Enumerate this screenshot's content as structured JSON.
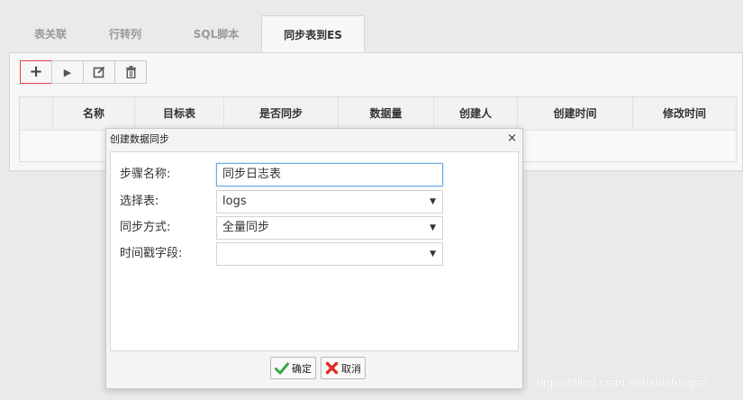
{
  "tabs": [
    "表关联",
    "行转列",
    "SQL脚本",
    "同步表到ES"
  ],
  "toolbar": {
    "add": "+",
    "run": "▶",
    "edit_icon": "edit-icon",
    "delete_icon": "trash-icon"
  },
  "table": {
    "columns": [
      "名称",
      "目标表",
      "是否同步",
      "数据量",
      "创建人",
      "创建时间",
      "修改时间"
    ]
  },
  "dialog": {
    "title": "创建数据同步",
    "close": "×",
    "fields": {
      "step_name_label": "步骤名称:",
      "step_name_value": "同步日志表",
      "table_label": "选择表:",
      "table_value": "logs",
      "mode_label": "同步方式:",
      "mode_value": "全量同步",
      "timestamp_label": "时间戳字段:",
      "timestamp_value": ""
    },
    "ok_label": "确定",
    "cancel_label": "取消"
  },
  "watermark": "https://blog.csdn.net/zhuifengsn",
  "colors": {
    "accent_red": "#e34141",
    "focus_blue": "#6aa8e8",
    "ok_green": "#3aa64a",
    "cancel_red": "#e0302a"
  }
}
